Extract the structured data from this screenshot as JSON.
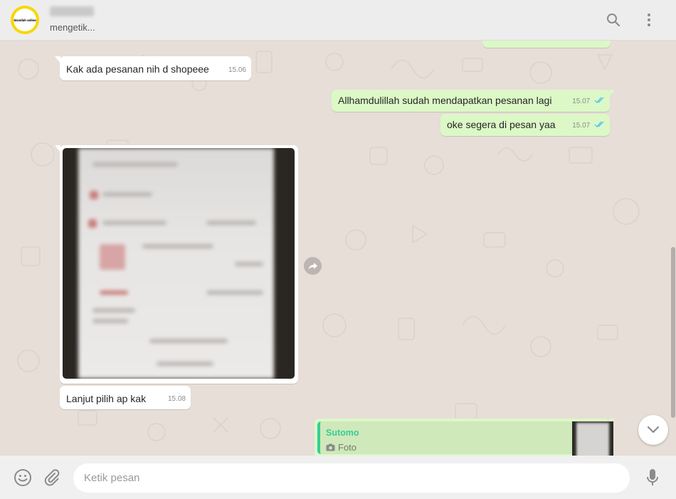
{
  "header": {
    "avatar_text": "bismilah online",
    "contact_status": "mengetik..."
  },
  "messages": [
    {
      "id": "m1",
      "direction": "in",
      "text": "Kak ada pesanan nih d shopeee",
      "time": "15.06"
    },
    {
      "id": "m2",
      "direction": "out",
      "text": "Allhamdulillah sudah mendapatkan pesanan lagi",
      "time": "15.07",
      "status": "read"
    },
    {
      "id": "m3",
      "direction": "out",
      "text": "oke segera di pesan yaa",
      "time": "15.07",
      "status": "read"
    },
    {
      "id": "m4",
      "direction": "in",
      "type": "photo"
    },
    {
      "id": "m5",
      "direction": "in",
      "text": "Lanjut pilih ap kak",
      "time": "15.08"
    },
    {
      "id": "m6",
      "direction": "out",
      "type": "reply",
      "quote_name": "Sutomo",
      "quote_type": "Foto"
    }
  ],
  "composer": {
    "placeholder": "Ketik pesan"
  },
  "icons": {
    "search": "search-icon",
    "menu": "menu-dots-icon",
    "emoji": "emoji-icon",
    "attach": "paperclip-icon",
    "mic": "microphone-icon",
    "forward": "forward-icon",
    "scroll_down": "chevron-down-icon",
    "camera": "camera-icon"
  },
  "colors": {
    "header_bg": "#ededed",
    "chat_bg": "#e5ddd5",
    "incoming_bubble": "#ffffff",
    "outgoing_bubble": "#dcf8c6",
    "read_tick": "#4fc3f7",
    "quote_accent": "#35cd96"
  }
}
